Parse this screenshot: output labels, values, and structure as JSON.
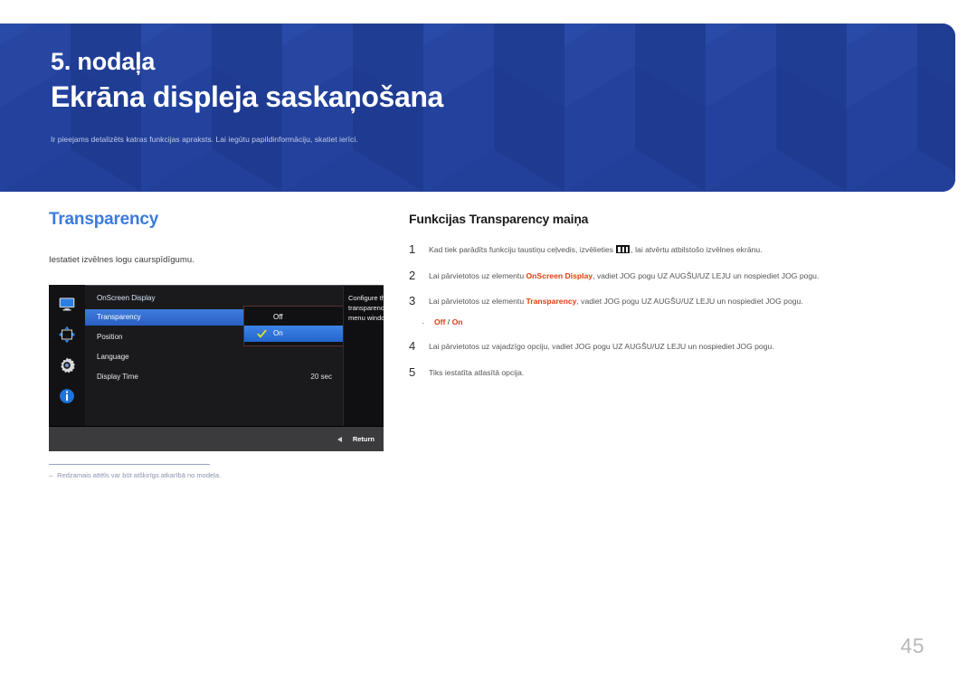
{
  "banner": {
    "chapter_number": "5. nodaļa",
    "chapter_title": "Ekrāna displeja saskaņošana",
    "chapter_subtitle": "Ir pieejams detalizēts katras funkcijas apraksts. Lai iegūtu papildinformāciju, skatiet ierīci.",
    "bg_color": "#22409A",
    "title_color": "#FFFFFF",
    "subtitle_color": "#C3CBE8"
  },
  "left": {
    "section_title": "Transparency",
    "section_title_color": "#3B7BDD",
    "section_description": "Iestatiet izvēlnes logu caurspīdīgumu.",
    "footnote_dash": "‒",
    "footnote": "Redzamais attēls var būt atšķirīgs atkarībā no modeļa."
  },
  "osd": {
    "menu_title": "OnScreen Display",
    "rail_icons": [
      "display-monitor-icon",
      "position-arrows-icon",
      "gear-settings-icon",
      "information-icon"
    ],
    "rows": [
      {
        "label": "Transparency",
        "value": "",
        "selected": true
      },
      {
        "label": "Position",
        "value": "",
        "selected": false
      },
      {
        "label": "Language",
        "value": "",
        "selected": false
      },
      {
        "label": "Display Time",
        "value": "20 sec",
        "selected": false
      }
    ],
    "dropdown": [
      {
        "label": "Off",
        "selected": false
      },
      {
        "label": "On",
        "selected": true
      }
    ],
    "description": "Configure the\ntransparency of the\nmenu windows.",
    "return_label": "Return",
    "selected_color": "#3F7DDF",
    "check_color": "#D7E030"
  },
  "right": {
    "steps_title": "Funkcijas Transparency maiņa",
    "steps": [
      {
        "num": "1",
        "pre": "Kad tiek parādīts funkciju taustiņu ceļvedis, izvēlieties ",
        "glyph": "menu-icon",
        "post": ", lai atvērtu atbilstošo izvēlnes ekrānu."
      },
      {
        "num": "2",
        "pre": "Lai pārvietotos uz elementu ",
        "highlight": "OnScreen Display",
        "post": ", vadiet JOG pogu UZ AUGŠU/UZ LEJU un nospiediet JOG pogu."
      },
      {
        "num": "3",
        "pre": "Lai pārvietotos uz elementu ",
        "highlight": "Transparency",
        "post": ", vadiet JOG pogu UZ AUGŠU/UZ LEJU un nospiediet JOG pogu."
      },
      {
        "num": "4",
        "pre": "Lai pārvietotos uz vajadzīgo opciju, vadiet JOG pogu UZ AUGŠU/UZ LEJU un nospiediet JOG pogu.",
        "highlight": "",
        "post": ""
      },
      {
        "num": "5",
        "pre": "Tiks iestatīta atlasītā opcija.",
        "highlight": "",
        "post": ""
      }
    ],
    "bullet": {
      "dot": "·",
      "option_a": "Off",
      "separator": " / ",
      "option_b": "On"
    },
    "highlight_color": "#E23C10"
  },
  "page_number": "45"
}
